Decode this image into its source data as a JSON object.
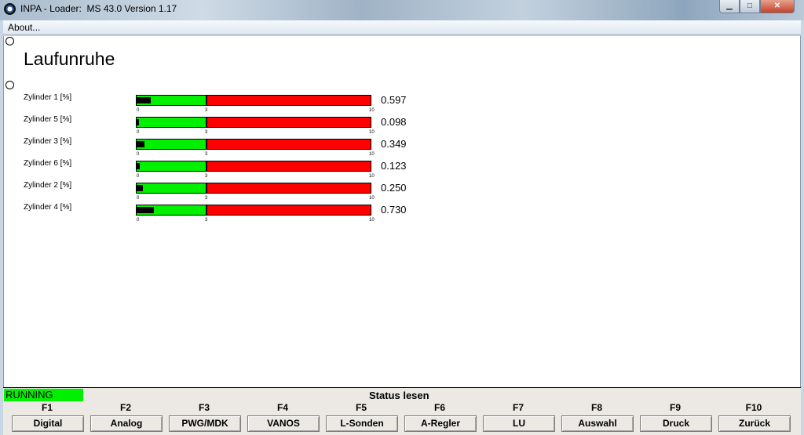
{
  "window": {
    "title": "INPA - Loader:  MS 43.0 Version 1.17",
    "minimize_glyph": "▁",
    "maximize_glyph": "□",
    "close_glyph": "✕"
  },
  "menu": {
    "about_label": "About..."
  },
  "main": {
    "heading": "Laufunruhe",
    "scale": {
      "min_label": "0",
      "threshold_label": "3",
      "max_label": "10",
      "min": 0,
      "threshold": 3,
      "max": 10
    },
    "rows": [
      {
        "label": "Zylinder 1 [%]",
        "value": "0.597",
        "level": 0.597
      },
      {
        "label": "Zylinder 5 [%]",
        "value": "0.098",
        "level": 0.098
      },
      {
        "label": "Zylinder 3 [%]",
        "value": "0.349",
        "level": 0.349
      },
      {
        "label": "Zylinder 6 [%]",
        "value": "0.123",
        "level": 0.123
      },
      {
        "label": "Zylinder 2 [%]",
        "value": "0.250",
        "level": 0.25
      },
      {
        "label": "Zylinder 4 [%]",
        "value": "0.730",
        "level": 0.73
      }
    ]
  },
  "status": {
    "state": "RUNNING",
    "title": "Status lesen",
    "state_color": "#00f000"
  },
  "fkeys": [
    {
      "key": "F1",
      "label": "Digital"
    },
    {
      "key": "F2",
      "label": "Analog"
    },
    {
      "key": "F3",
      "label": "PWG/MDK"
    },
    {
      "key": "F4",
      "label": "VANOS"
    },
    {
      "key": "F5",
      "label": "L-Sonden"
    },
    {
      "key": "F6",
      "label": "A-Regler"
    },
    {
      "key": "F7",
      "label": "LU"
    },
    {
      "key": "F8",
      "label": "Auswahl"
    },
    {
      "key": "F9",
      "label": "Druck"
    },
    {
      "key": "F10",
      "label": "Zurück"
    }
  ],
  "colors": {
    "ok_zone": "#00f000",
    "alarm_zone": "#ff0000",
    "fill": "#000000"
  }
}
